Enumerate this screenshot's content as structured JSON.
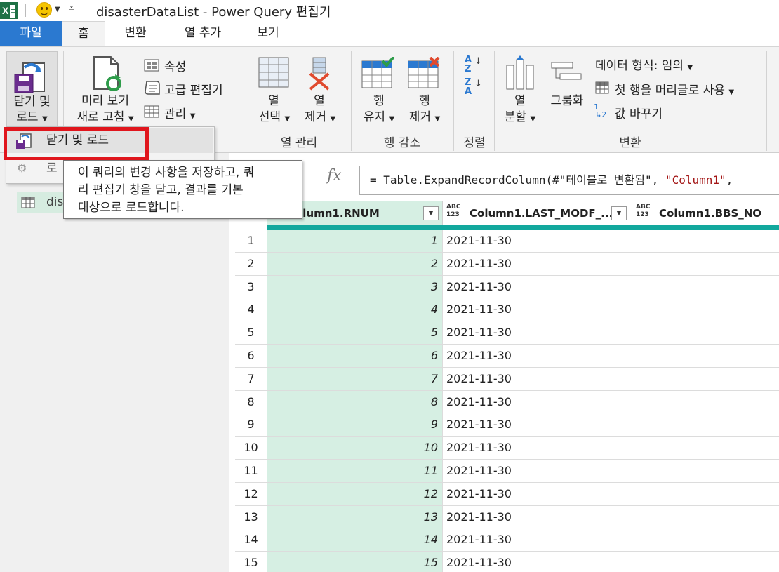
{
  "window": {
    "title": "disasterDataList - Power Query 편집기",
    "app_icon": "excel-icon"
  },
  "tabs": [
    "파일",
    "홈",
    "변환",
    "열 추가",
    "보기"
  ],
  "ribbon": {
    "close_load": {
      "line1": "닫기 및",
      "line2": "로드"
    },
    "refresh": {
      "line1": "미리 보기",
      "line2": "새로 고침"
    },
    "properties": "속성",
    "advanced_editor": "고급 편집기",
    "manage": "관리",
    "choose_columns": {
      "line1": "열",
      "line2": "선택"
    },
    "remove_columns": {
      "line1": "열",
      "line2": "제거"
    },
    "keep_rows": {
      "line1": "행",
      "line2": "유지"
    },
    "remove_rows": {
      "line1": "행",
      "line2": "제거"
    },
    "split_column": {
      "line1": "열",
      "line2": "분할"
    },
    "group_by": "그룹화",
    "data_type": "데이터 형식: 임의",
    "use_first_row": "첫 행을 머리글로 사용",
    "replace_values": "값 바꾸기",
    "groups": {
      "manage_columns": "열 관리",
      "reduce_rows": "행 감소",
      "sort": "정렬",
      "transform": "변환"
    }
  },
  "menu": {
    "close_and_load": "닫기 및 로드",
    "close_and_load_to_partial": "로"
  },
  "tooltip": {
    "line1": "이 쿼리의 변경 사항을 저장하고, 쿼",
    "line2": "리 편집기 창을 닫고, 결과를 기본",
    "line3": "대상으로 로드합니다."
  },
  "queries": {
    "item_partial": "dis"
  },
  "formula": {
    "prefix": "= Table.ExpandRecordColumn(#\"테이블로 변환됨\", ",
    "string": "\"Column1\"",
    "suffix": ","
  },
  "grid": {
    "columns": [
      {
        "type_top": "",
        "type_bottom": "",
        "name": "olumn1.RNUM"
      },
      {
        "type_top": "ABC",
        "type_bottom": "123",
        "name": "Column1.LAST_MODF_..."
      },
      {
        "type_top": "ABC",
        "type_bottom": "123",
        "name": "Column1.BBS_NO"
      }
    ],
    "rows": [
      [
        "1",
        "1",
        "2021-11-30",
        ""
      ],
      [
        "2",
        "2",
        "2021-11-30",
        ""
      ],
      [
        "3",
        "3",
        "2021-11-30",
        ""
      ],
      [
        "4",
        "4",
        "2021-11-30",
        ""
      ],
      [
        "5",
        "5",
        "2021-11-30",
        ""
      ],
      [
        "6",
        "6",
        "2021-11-30",
        ""
      ],
      [
        "7",
        "7",
        "2021-11-30",
        ""
      ],
      [
        "8",
        "8",
        "2021-11-30",
        ""
      ],
      [
        "9",
        "9",
        "2021-11-30",
        ""
      ],
      [
        "10",
        "10",
        "2021-11-30",
        ""
      ],
      [
        "11",
        "11",
        "2021-11-30",
        ""
      ],
      [
        "12",
        "12",
        "2021-11-30",
        ""
      ],
      [
        "13",
        "13",
        "2021-11-30",
        ""
      ],
      [
        "14",
        "14",
        "2021-11-30",
        ""
      ],
      [
        "15",
        "15",
        "2021-11-30",
        ""
      ]
    ]
  },
  "colors": {
    "file_tab": "#2b79d0",
    "highlight_box": "#e0161d",
    "column_header_accent": "#12a89d",
    "selected_column": "#d6efe3"
  }
}
